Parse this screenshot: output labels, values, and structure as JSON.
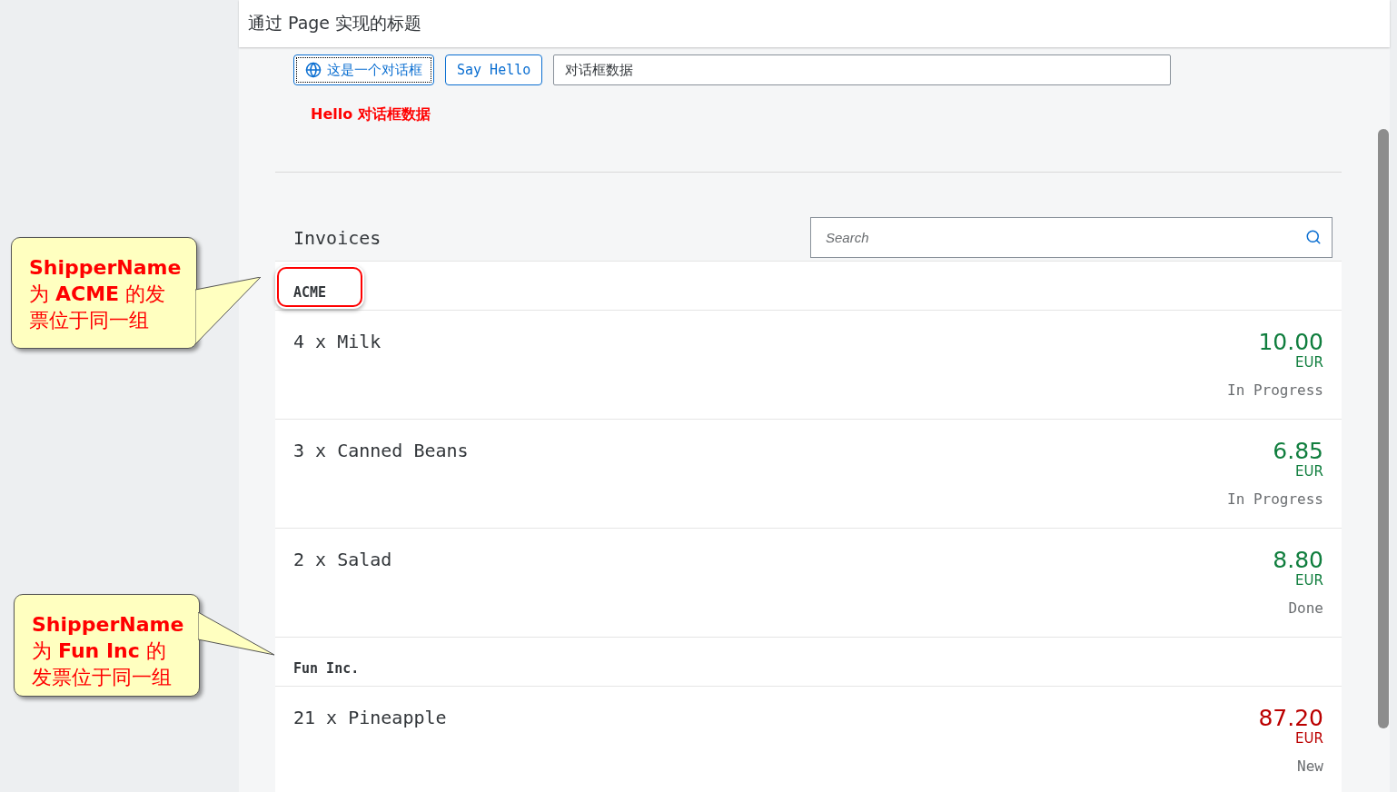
{
  "header": {
    "title": "通过 Page 实现的标题"
  },
  "toolbar": {
    "buttons": [
      {
        "label": "这是一个对话框",
        "focused": true
      },
      {
        "label": "Say Hello",
        "focused": false
      }
    ],
    "input": {
      "value": "对话框数据"
    }
  },
  "message": "Hello 对话框数据",
  "invoices": {
    "title": "Invoices",
    "search": {
      "placeholder": "Search"
    },
    "groups": [
      {
        "name": "ACME",
        "highlighted": true,
        "items": [
          {
            "title": "4 x Milk",
            "amount": "10.00",
            "currency": "EUR",
            "status": "In Progress",
            "color": "#107e3e"
          },
          {
            "title": "3 x Canned Beans",
            "amount": "6.85",
            "currency": "EUR",
            "status": "In Progress",
            "color": "#107e3e"
          },
          {
            "title": "2 x Salad",
            "amount": "8.80",
            "currency": "EUR",
            "status": "Done",
            "color": "#107e3e"
          }
        ]
      },
      {
        "name": "Fun Inc.",
        "highlighted": false,
        "items": [
          {
            "title": "21 x Pineapple",
            "amount": "87.20",
            "currency": "EUR",
            "status": "New",
            "color": "#bb0000"
          }
        ]
      }
    ]
  },
  "annotations": [
    {
      "text": "**ShipperName** 为 **ACME** 的发票位于同一组"
    },
    {
      "text": "**ShipperName** 为 **Fun Inc** 的发票位于同一组"
    }
  ]
}
